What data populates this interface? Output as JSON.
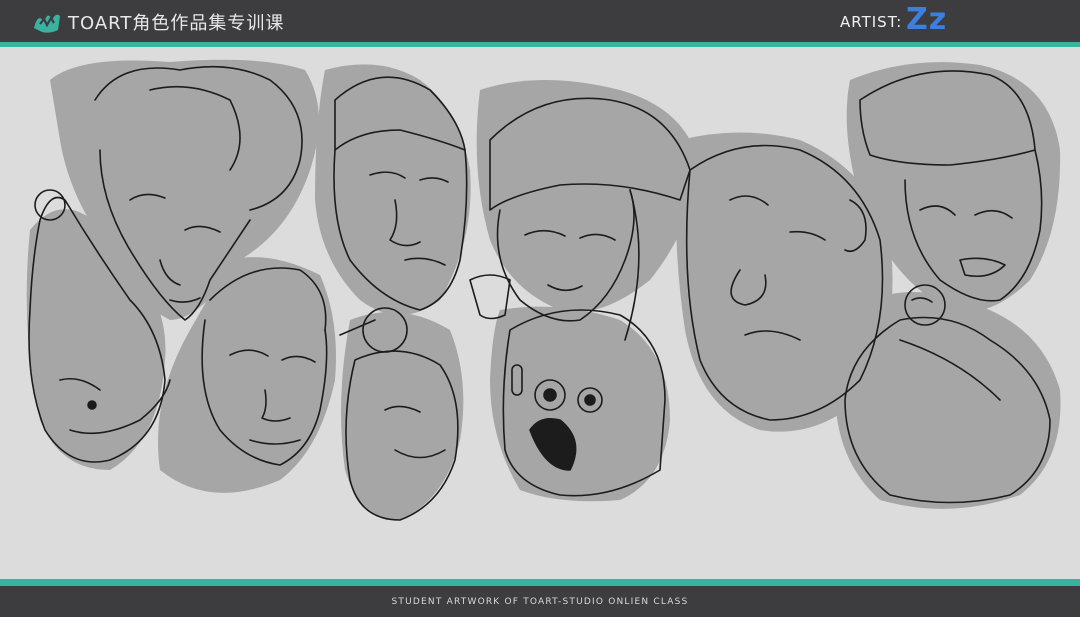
{
  "header": {
    "brand": "TOART角色作品集专训课",
    "artist_label": "ARTIST:",
    "artist_name": "Zz",
    "logo_icon": "toart-logo-icon"
  },
  "artwork": {
    "subject": "character head sketches",
    "faces": [
      "woman-with-bun",
      "elf-in-pointed-hat",
      "man-in-beanie-with-pipe",
      "young-man-in-cap",
      "old-woman-with-topknot",
      "girl-in-knit-hat",
      "robot-head",
      "sleepy-big-face-man",
      "angry-man-flat-top",
      "bald-man-with-beard"
    ]
  },
  "footer": {
    "text": "STUDENT ARTWORK OF TOART-STUDIO ONLIEN CLASS"
  },
  "colors": {
    "bar": "#3d3d3f",
    "accent": "#3bb1a0",
    "canvas": "#dcdcdc",
    "artist": "#3b7fe0"
  }
}
